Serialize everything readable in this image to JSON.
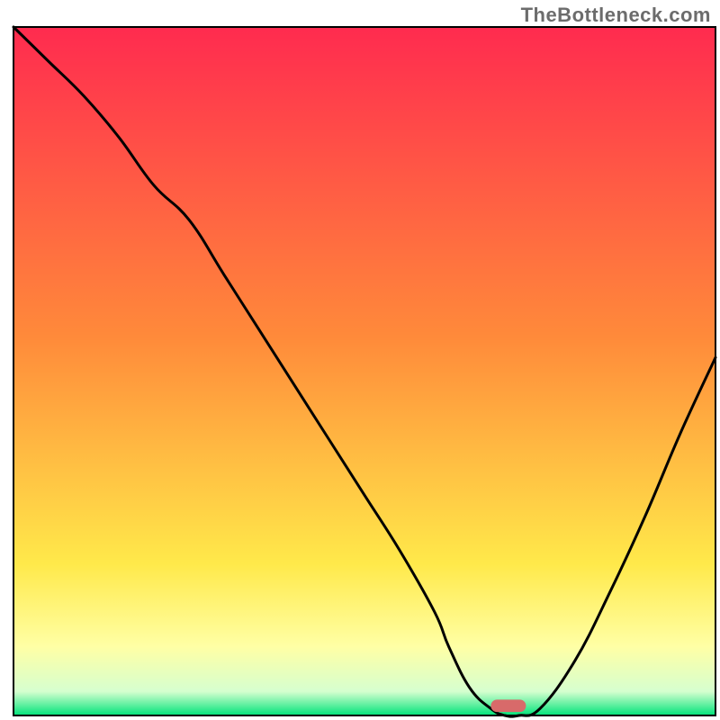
{
  "watermark": "TheBottleneck.com",
  "chart_data": {
    "type": "line",
    "title": "",
    "xlabel": "",
    "ylabel": "",
    "xlim": [
      0,
      100
    ],
    "ylim": [
      0,
      100
    ],
    "grid": false,
    "background_gradient": {
      "stops": [
        {
          "offset": 0.0,
          "color": "#ff2b4f"
        },
        {
          "offset": 0.45,
          "color": "#ff8a3a"
        },
        {
          "offset": 0.78,
          "color": "#ffe94a"
        },
        {
          "offset": 0.9,
          "color": "#ffffa5"
        },
        {
          "offset": 0.965,
          "color": "#d6ffcf"
        },
        {
          "offset": 1.0,
          "color": "#00e37a"
        }
      ]
    },
    "series": [
      {
        "name": "bottleneck-curve",
        "color": "#000000",
        "x": [
          0,
          5,
          10,
          15,
          20,
          25,
          30,
          35,
          40,
          45,
          50,
          55,
          60,
          62,
          65,
          68,
          70,
          72,
          75,
          80,
          85,
          90,
          95,
          100
        ],
        "y": [
          100,
          95,
          90,
          84,
          77,
          72,
          64,
          56,
          48,
          40,
          32,
          24,
          15,
          10,
          4,
          1,
          0,
          0,
          1,
          8,
          18,
          29,
          41,
          52
        ]
      }
    ],
    "marker": {
      "name": "optimal-range",
      "color": "#d86a6a",
      "x_start": 68,
      "x_end": 73,
      "y": 0.5,
      "height": 1.8
    },
    "frame": {
      "color": "#000000",
      "stroke_width": 2
    }
  }
}
